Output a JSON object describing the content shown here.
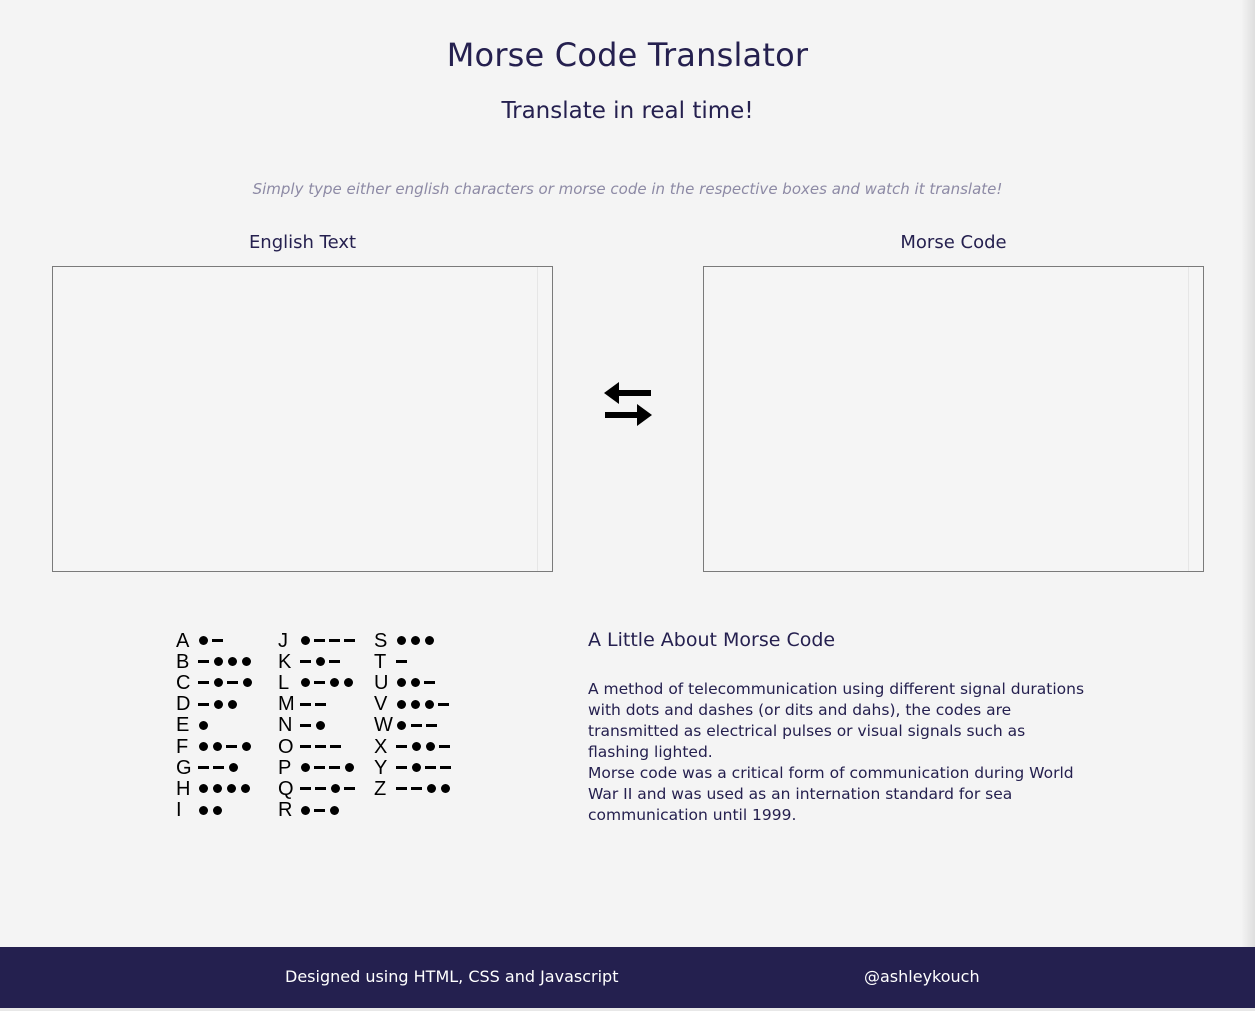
{
  "header": {
    "title": "Morse Code Translator",
    "subtitle": "Translate in real time!",
    "instructions": "Simply type either english characters or morse code in the respective boxes and watch it translate!"
  },
  "translator": {
    "english_label": "English Text",
    "morse_label": "Morse Code",
    "english_value": "",
    "morse_value": "",
    "swap_icon": "swap-arrows-icon"
  },
  "morse_chart": [
    {
      "letter": "A",
      "code": ".-"
    },
    {
      "letter": "B",
      "code": "-..."
    },
    {
      "letter": "C",
      "code": "-.-."
    },
    {
      "letter": "D",
      "code": "-.."
    },
    {
      "letter": "E",
      "code": "."
    },
    {
      "letter": "F",
      "code": "..-."
    },
    {
      "letter": "G",
      "code": "--."
    },
    {
      "letter": "H",
      "code": "...."
    },
    {
      "letter": "I",
      "code": ".."
    },
    {
      "letter": "J",
      "code": ".---"
    },
    {
      "letter": "K",
      "code": "-.-"
    },
    {
      "letter": "L",
      "code": ".-.."
    },
    {
      "letter": "M",
      "code": "--"
    },
    {
      "letter": "N",
      "code": "-."
    },
    {
      "letter": "O",
      "code": "---"
    },
    {
      "letter": "P",
      "code": ".--."
    },
    {
      "letter": "Q",
      "code": "--.-"
    },
    {
      "letter": "R",
      "code": ".-."
    },
    {
      "letter": "S",
      "code": "..."
    },
    {
      "letter": "T",
      "code": "-"
    },
    {
      "letter": "U",
      "code": "..-"
    },
    {
      "letter": "V",
      "code": "...-"
    },
    {
      "letter": "W",
      "code": ".--"
    },
    {
      "letter": "X",
      "code": "-..-"
    },
    {
      "letter": "Y",
      "code": "-.--"
    },
    {
      "letter": "Z",
      "code": "--.."
    }
  ],
  "about": {
    "title": "A Little About Morse Code",
    "paragraph1": "A method of telecommunication using different signal durations with dots and dashes (or dits and dahs), the codes are transmitted as electrical pulses or visual signals such as flashing lighted.",
    "paragraph2": "Morse code was a critical form of communication during World War II and was used as an internation standard for sea communication until 1999."
  },
  "footer": {
    "designed_text": "Designed using HTML, CSS and Javascript",
    "handle": "@ashleykouch"
  },
  "colors": {
    "primary": "#24204f",
    "background": "#f4f4f4",
    "muted": "#8d8aa5"
  }
}
